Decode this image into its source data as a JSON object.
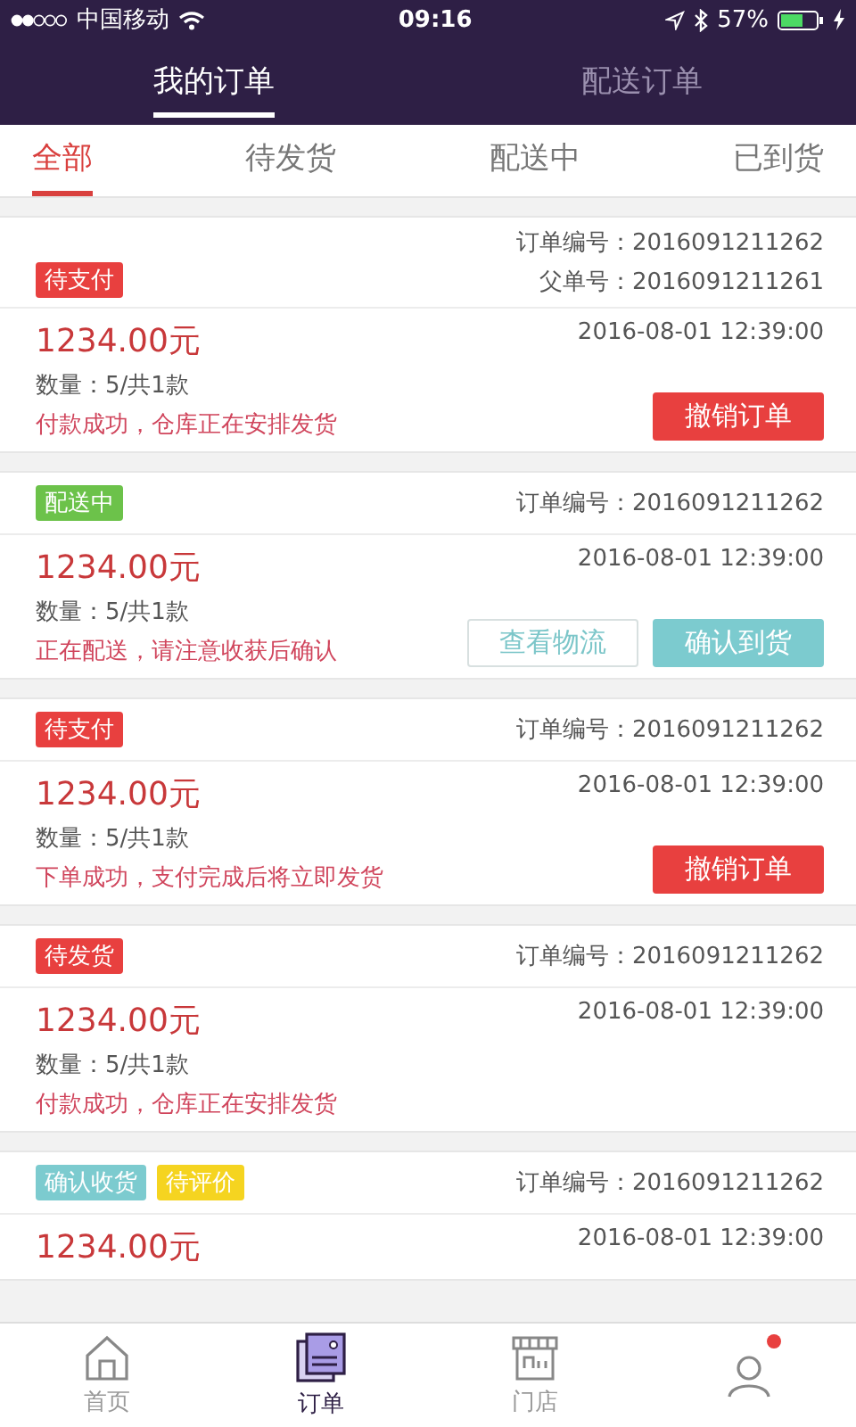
{
  "status_bar": {
    "carrier": "中国移动",
    "time": "09:16",
    "battery": "57%"
  },
  "header_tabs": [
    {
      "label": "我的订单",
      "selected": true
    },
    {
      "label": "配送订单",
      "selected": false
    }
  ],
  "filter_tabs": [
    {
      "label": "全部",
      "selected": true
    },
    {
      "label": "待发货",
      "selected": false
    },
    {
      "label": "配送中",
      "selected": false
    },
    {
      "label": "已到货",
      "selected": false
    }
  ],
  "orders": [
    {
      "tags": [
        {
          "text": "待支付",
          "color": "#e8403f"
        }
      ],
      "order_no": "订单编号：2016091211262",
      "parent_no": "父单号：2016091211261",
      "price": "1234.00元",
      "date": "2016-08-01 12:39:00",
      "quantity": "数量：5/共1款",
      "message": "付款成功，仓库正在安排发货",
      "buttons": [
        {
          "label": "撤销订单",
          "kind": "danger"
        }
      ]
    },
    {
      "tags": [
        {
          "text": "配送中",
          "color": "#6cc24a"
        }
      ],
      "order_no": "订单编号：2016091211262",
      "price": "1234.00元",
      "date": "2016-08-01 12:39:00",
      "quantity": "数量：5/共1款",
      "message": "正在配送，请注意收获后确认",
      "buttons": [
        {
          "label": "查看物流",
          "kind": "outline"
        },
        {
          "label": "确认到货",
          "kind": "confirm"
        }
      ]
    },
    {
      "tags": [
        {
          "text": "待支付",
          "color": "#e8403f"
        }
      ],
      "order_no": "订单编号：2016091211262",
      "price": "1234.00元",
      "date": "2016-08-01 12:39:00",
      "quantity": "数量：5/共1款",
      "message": "下单成功，支付完成后将立即发货",
      "buttons": [
        {
          "label": "撤销订单",
          "kind": "danger"
        }
      ]
    },
    {
      "tags": [
        {
          "text": "待发货",
          "color": "#e8403f"
        }
      ],
      "order_no": "订单编号：2016091211262",
      "price": "1234.00元",
      "date": "2016-08-01 12:39:00",
      "quantity": "数量：5/共1款",
      "message": "付款成功，仓库正在安排发货"
    },
    {
      "tags": [
        {
          "text": "确认收货",
          "color": "#7ccbcf"
        },
        {
          "text": "待评价",
          "color": "#f5d420"
        }
      ],
      "order_no": "订单编号：2016091211262",
      "price": "1234.00元",
      "date": "2016-08-01 12:39:00"
    }
  ],
  "bottom_nav": [
    {
      "kind": "home",
      "label": "首页",
      "selected": false
    },
    {
      "kind": "orders",
      "label": "订单",
      "selected": true
    },
    {
      "kind": "store",
      "label": "门店",
      "selected": false
    },
    {
      "kind": "profile",
      "selected": false,
      "badge": true
    }
  ]
}
